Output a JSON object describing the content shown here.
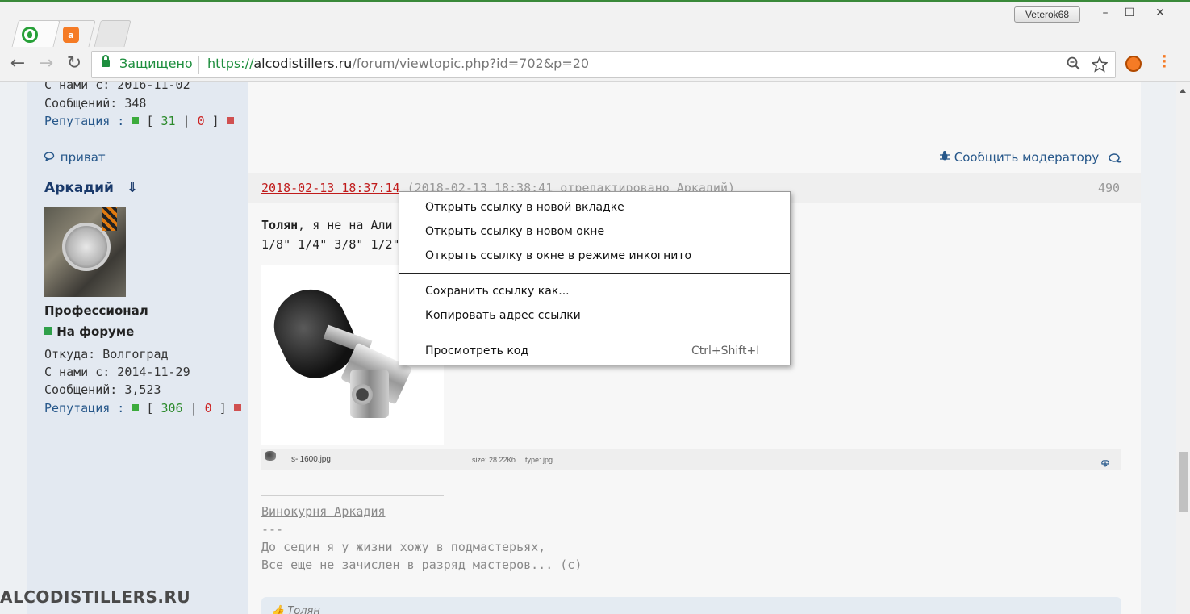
{
  "browser": {
    "profile_name": "Veterok68",
    "window_controls": {
      "minimize": "–",
      "maximize": "☐",
      "close": "✕"
    },
    "nav": {
      "back": "←",
      "forward": "→",
      "reload": "↻"
    },
    "security_label": "Защищено",
    "url_scheme": "https://",
    "url_host": "alcodistillers.ru",
    "url_path": "/forum/viewtopic.php?id=702&p=20",
    "icons": [
      "zoom-icon",
      "star-icon",
      "extension-icon",
      "menu-icon"
    ],
    "accent_color": "#1e8e3e"
  },
  "prev_post": {
    "joined": "С нами с: 2016-11-02",
    "messages": "Сообщений: 348",
    "rep_label": "Репутация :",
    "rep_plus": "31",
    "rep_minus": "0",
    "private_label": "приват",
    "report_label": "Сообщить модератору"
  },
  "post": {
    "author": "Аркадий",
    "author_arrow": "⇓",
    "rank": "Профессионал",
    "online": "На форуме",
    "from": "Откуда: Волгоград",
    "joined": "С нами с: 2014-11-29",
    "messages": "Сообщений: 3,523",
    "rep_label": "Репутация :",
    "rep_plus": "306",
    "rep_minus": "0",
    "date": "2018-02-13 18:37:14",
    "edited": "(2018-02-13 18:38:41 отредактировано Аркадий)",
    "number": "490",
    "text_bold": "Толян",
    "text_rest": ", я не на Али п",
    "text_line2": "1/8\" 1/4\" 3/8\" 1/2\" 3/",
    "attachment": {
      "filename": "s-l1600.jpg",
      "size": "size: 28.22Кб",
      "type": "type: jpg"
    },
    "signature": {
      "title": "Винокурня Аркадия",
      "dashes": "---",
      "line1": "До седин я у жизни хожу в подмастерьях,",
      "line2": "Все еще не зачислен в разряд мастеров... (с)"
    },
    "quote_author": "Толян"
  },
  "watermark": "ALCODISTILLERS.RU",
  "context_menu": {
    "items": [
      "Открыть ссылку в новой вкладке",
      "Открыть ссылку в новом окне",
      "Открыть ссылку в окне в режиме инкогнито",
      "Сохранить ссылку как...",
      "Копировать адрес ссылки",
      "Просмотреть код"
    ],
    "inspect_shortcut": "Ctrl+Shift+I"
  }
}
